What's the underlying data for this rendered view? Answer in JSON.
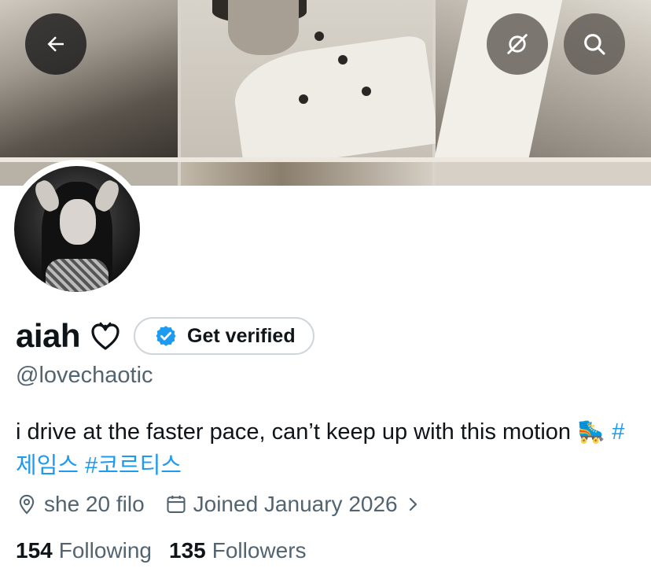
{
  "header": {
    "back_icon": "arrow-left-icon",
    "grok_icon": "slash-circle-icon",
    "search_icon": "search-icon"
  },
  "profile": {
    "display_name": "aiah",
    "name_emoji": "ribbon-heart-icon",
    "verify_button_label": "Get verified",
    "handle": "@lovechaotic",
    "bio_text": "i drive at the faster pace, can’t keep up with this motion",
    "bio_emoji": "🛼",
    "hashtags": [
      "#제임스",
      "#코르티스"
    ],
    "location": "she 20 filo",
    "joined": "Joined January 2026",
    "following_count": "154",
    "following_label": "Following",
    "followers_count": "135",
    "followers_label": "Followers"
  },
  "colors": {
    "link": "#1d9bf0",
    "secondary_text": "#536471",
    "primary_text": "#0f1419",
    "verified_badge": "#1d9bf0"
  }
}
